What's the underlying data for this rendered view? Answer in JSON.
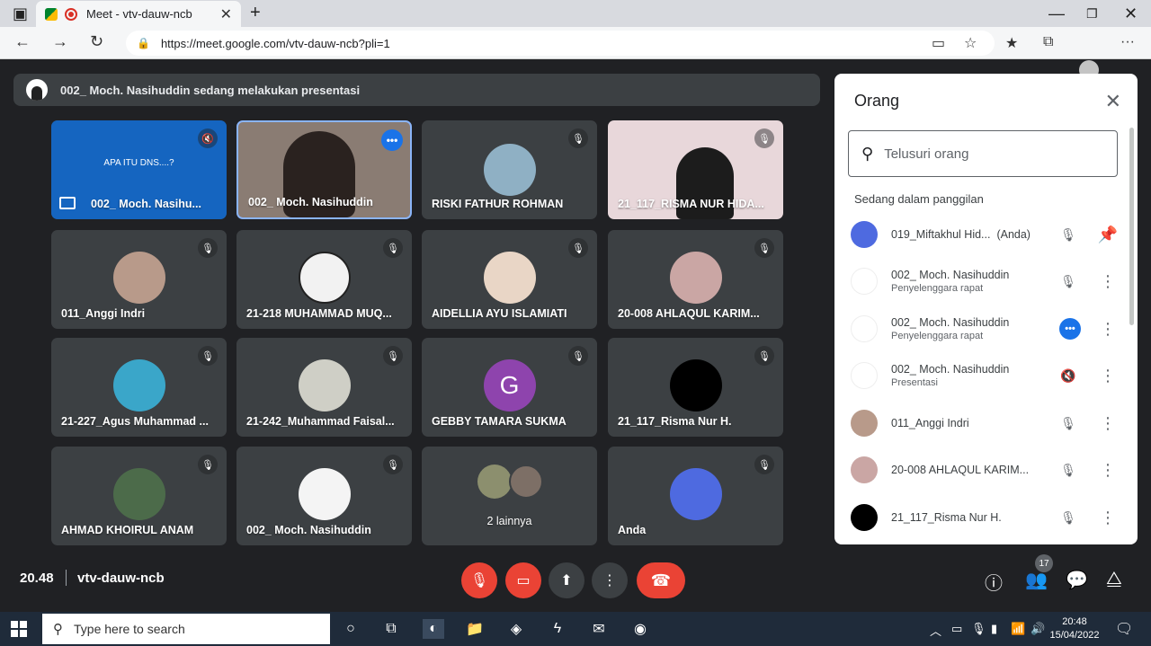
{
  "browser": {
    "tab_title": "Meet - vtv-dauw-ncb",
    "url": "https://meet.google.com/vtv-dauw-ncb?pli=1"
  },
  "presenting_banner": "002_ Moch. Nasihuddin sedang melakukan presentasi",
  "tiles": [
    {
      "name": "002_ Moch. Nasihu...",
      "slide_text": "APA ITU DNS....?"
    },
    {
      "name": "002_ Moch. Nasihuddin"
    },
    {
      "name": "RISKI FATHUR ROHMAN"
    },
    {
      "name": "21_117_RISMA NUR HIDA..."
    },
    {
      "name": "011_Anggi Indri"
    },
    {
      "name": "21-218 MUHAMMAD MUQ..."
    },
    {
      "name": "AIDELLIA AYU ISLAMIATI"
    },
    {
      "name": "20-008 AHLAQUL KARIM..."
    },
    {
      "name": "21-227_Agus Muhammad ..."
    },
    {
      "name": "21-242_Muhammad Faisal..."
    },
    {
      "name": "GEBBY TAMARA SUKMA",
      "letter": "G"
    },
    {
      "name": "21_117_Risma Nur H."
    },
    {
      "name": "AHMAD KHOIRUL ANAM"
    },
    {
      "name": "002_ Moch. Nasihuddin"
    },
    {
      "name": "2 lainnya"
    },
    {
      "name": "Anda"
    }
  ],
  "controls": {
    "time": "20.48",
    "meeting_code": "vtv-dauw-ncb",
    "people_count": "17"
  },
  "people_panel": {
    "title": "Orang",
    "search_placeholder": "Telusuri orang",
    "section": "Sedang dalam panggilan",
    "people": [
      {
        "name": "019_Miftakhul Hid...",
        "suffix": "(Anda)",
        "role": ""
      },
      {
        "name": "002_ Moch. Nasihuddin",
        "role": "Penyelenggara rapat"
      },
      {
        "name": "002_ Moch. Nasihuddin",
        "role": "Penyelenggara rapat"
      },
      {
        "name": "002_ Moch. Nasihuddin",
        "role": "Presentasi"
      },
      {
        "name": "011_Anggi Indri",
        "role": ""
      },
      {
        "name": "20-008 AHLAQUL KARIM...",
        "role": ""
      },
      {
        "name": "21_117_Risma Nur H.",
        "role": ""
      }
    ]
  },
  "taskbar": {
    "search_placeholder": "Type here to search",
    "clock_time": "20:48",
    "clock_date": "15/04/2022"
  }
}
